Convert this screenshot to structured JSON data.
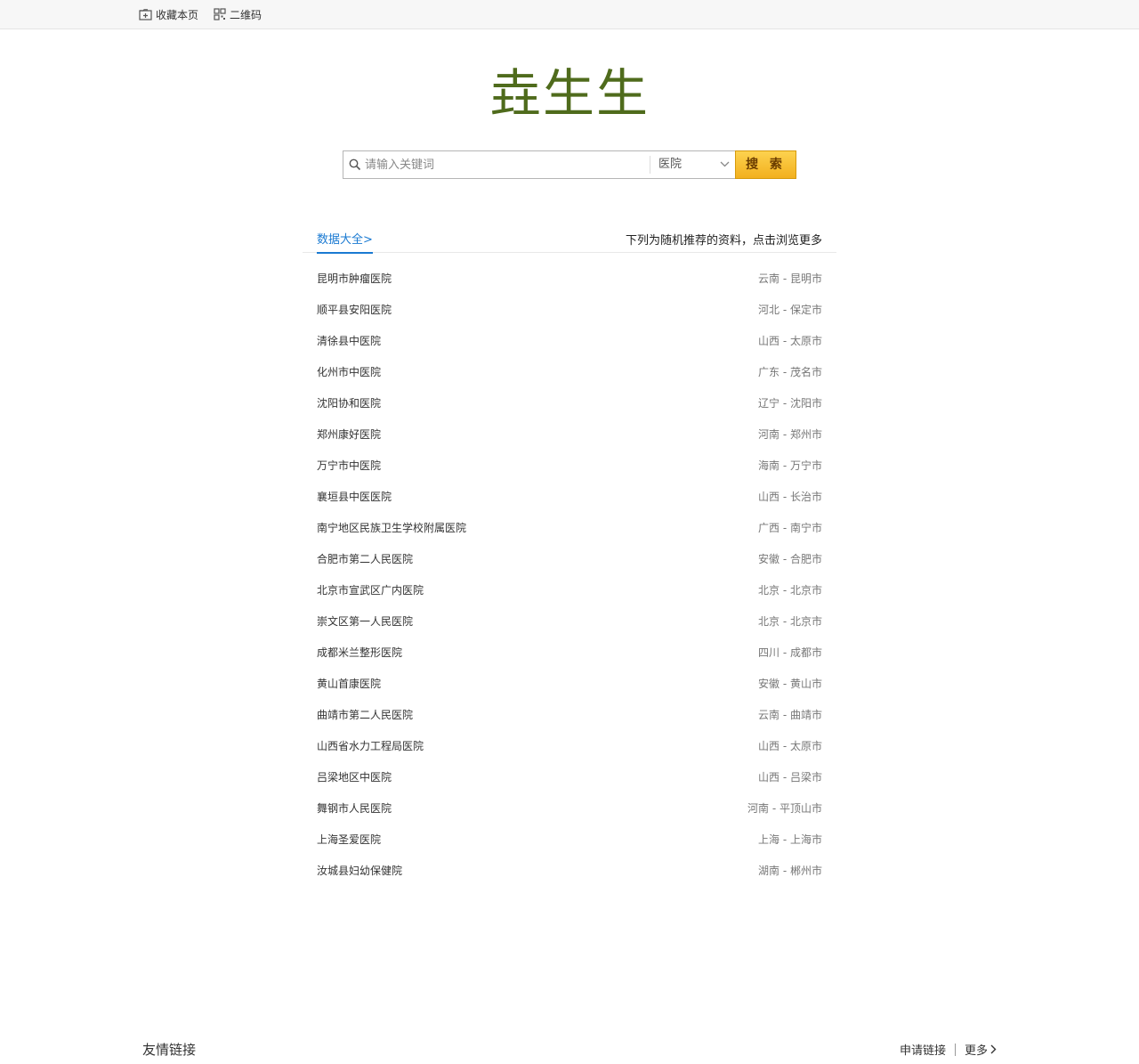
{
  "topbar": {
    "favorite_label": "收藏本页",
    "qrcode_label": "二维码"
  },
  "logo": {
    "text": "垚生生"
  },
  "search": {
    "placeholder": "请输入关键词",
    "category": "医院",
    "button_label": "搜 索"
  },
  "section": {
    "tab_label": "数据大全>",
    "note": "下列为随机推荐的资料，点击浏览更多"
  },
  "items": [
    {
      "name": "昆明市肿瘤医院",
      "region": "云南 - 昆明市"
    },
    {
      "name": "顺平县安阳医院",
      "region": "河北 - 保定市"
    },
    {
      "name": "清徐县中医院",
      "region": "山西 - 太原市"
    },
    {
      "name": "化州市中医院",
      "region": "广东 - 茂名市"
    },
    {
      "name": "沈阳协和医院",
      "region": "辽宁 - 沈阳市"
    },
    {
      "name": "郑州康好医院",
      "region": "河南 - 郑州市"
    },
    {
      "name": "万宁市中医院",
      "region": "海南 - 万宁市"
    },
    {
      "name": "襄垣县中医医院",
      "region": "山西 - 长治市"
    },
    {
      "name": "南宁地区民族卫生学校附属医院",
      "region": "广西 - 南宁市"
    },
    {
      "name": "合肥市第二人民医院",
      "region": "安徽 - 合肥市"
    },
    {
      "name": "北京市宣武区广内医院",
      "region": "北京 - 北京市"
    },
    {
      "name": "崇文区第一人民医院",
      "region": "北京 - 北京市"
    },
    {
      "name": "成都米兰整形医院",
      "region": "四川 - 成都市"
    },
    {
      "name": "黄山首康医院",
      "region": "安徽 - 黄山市"
    },
    {
      "name": "曲靖市第二人民医院",
      "region": "云南 - 曲靖市"
    },
    {
      "name": "山西省水力工程局医院",
      "region": "山西 - 太原市"
    },
    {
      "name": "吕梁地区中医院",
      "region": "山西 - 吕梁市"
    },
    {
      "name": "舞钢市人民医院",
      "region": "河南 - 平顶山市"
    },
    {
      "name": "上海圣爱医院",
      "region": "上海 - 上海市"
    },
    {
      "name": "汝城县妇幼保健院",
      "region": "湖南 - 郴州市"
    }
  ],
  "footer": {
    "title": "友情链接",
    "apply_label": "申请链接",
    "more_label": "更多"
  }
}
